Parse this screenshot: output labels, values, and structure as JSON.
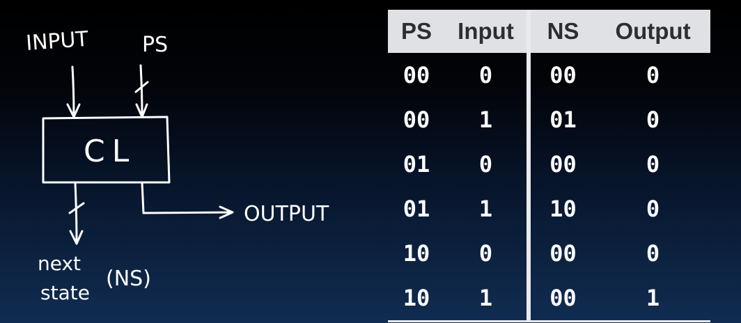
{
  "diagram": {
    "input_label": "INPUT",
    "ps_label": "PS",
    "block_label": "CL",
    "output_label": "OUTPUT",
    "next_label": "next",
    "state_label": "state",
    "ns_label": "(NS)"
  },
  "table": {
    "headers": [
      "PS",
      "Input",
      "NS",
      "Output"
    ],
    "rows": [
      [
        "00",
        "0",
        "00",
        "0"
      ],
      [
        "00",
        "1",
        "01",
        "0"
      ],
      [
        "01",
        "0",
        "00",
        "0"
      ],
      [
        "01",
        "1",
        "10",
        "0"
      ],
      [
        "10",
        "0",
        "00",
        "0"
      ],
      [
        "10",
        "1",
        "00",
        "1"
      ]
    ]
  }
}
